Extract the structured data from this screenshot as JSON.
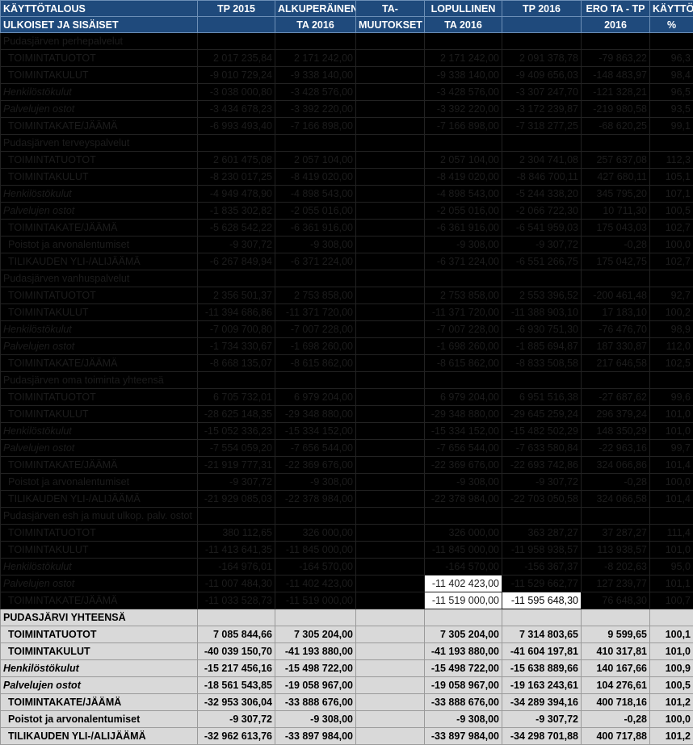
{
  "header": {
    "c1": [
      "KÄYTTÖTALOUS",
      "ULKOISET JA SISÄISET"
    ],
    "c2": [
      "TP 2015",
      ""
    ],
    "c3": [
      "ALKUPERÄINEN",
      "TA 2016"
    ],
    "c4": [
      "TA-",
      "MUUTOKSET"
    ],
    "c5": [
      "LOPULLINEN",
      "TA 2016"
    ],
    "c6": [
      "TP 2016",
      ""
    ],
    "c7": [
      "ERO TA - TP",
      "2016"
    ],
    "c8": [
      "KÄYTTÖ",
      "%"
    ]
  },
  "dark_rows": [
    {
      "label": "Pudasjärven perhepalvelut",
      "style": "sec",
      "v": [
        "",
        "",
        "",
        "",
        "",
        "",
        ""
      ]
    },
    {
      "label": "TOIMINTATUOTOT",
      "style": "sub",
      "v": [
        "2 017 235,84",
        "2 171 242,00",
        "",
        "2 171 242,00",
        "2 091 378,78",
        "-79 863,22",
        "96,3"
      ]
    },
    {
      "label": "TOIMINTAKULUT",
      "style": "sub",
      "v": [
        "-9 010 729,24",
        "-9 338 140,00",
        "",
        "-9 338 140,00",
        "-9 409 656,03",
        "-148 483,97",
        "98,4"
      ]
    },
    {
      "label": "Henkilöstökulut",
      "style": "it",
      "v": [
        "-3 038 000,80",
        "-3 428 576,00",
        "",
        "-3 428 576,00",
        "-3 307 247,70",
        "-121 328,21",
        "96,5"
      ]
    },
    {
      "label": "Palvelujen ostot",
      "style": "it",
      "v": [
        "-3 434 678,23",
        "-3 392 220,00",
        "",
        "-3 392 220,00",
        "-3 172 239,87",
        "-219 980,58",
        "93,5"
      ]
    },
    {
      "label": "TOIMINTAKATE/JÄÄMÄ",
      "style": "sub",
      "v": [
        "-6 993 493,40",
        "-7 166 898,00",
        "",
        "-7 166 898,00",
        "-7 318 277,25",
        "-68 620,25",
        "99,1"
      ]
    },
    {
      "label": "Pudasjärven terveyspalvelut",
      "style": "sec",
      "v": [
        "",
        "",
        "",
        "",
        "",
        "",
        ""
      ]
    },
    {
      "label": "TOIMINTATUOTOT",
      "style": "sub",
      "v": [
        "2 601 475,08",
        "2 057 104,00",
        "",
        "2 057 104,00",
        "2 304 741,08",
        "257 637,08",
        "112,3"
      ]
    },
    {
      "label": "TOIMINTAKULUT",
      "style": "sub",
      "v": [
        "-8 230 017,25",
        "-8 419 020,00",
        "",
        "-8 419 020,00",
        "-8 846 700,11",
        "427 680,11",
        "105,1"
      ]
    },
    {
      "label": "Henkilöstökulut",
      "style": "it",
      "v": [
        "-4 949 478,90",
        "-4 898 543,00",
        "",
        "-4 898 543,00",
        "-5 244 338,20",
        "345 795,20",
        "107,1"
      ]
    },
    {
      "label": "Palvelujen ostot",
      "style": "it",
      "v": [
        "-1 835 302,82",
        "-2 055 016,00",
        "",
        "-2 055 016,00",
        "-2 066 722,30",
        "10 711,30",
        "100,5"
      ]
    },
    {
      "label": "TOIMINTAKATE/JÄÄMÄ",
      "style": "sub",
      "v": [
        "-5 628 542,22",
        "-6 361 916,00",
        "",
        "-6 361 916,00",
        "-6 541 959,03",
        "175 043,03",
        "102,7"
      ]
    },
    {
      "label": "Poistot ja arvonalentumiset",
      "style": "sub",
      "v": [
        "-9 307,72",
        "-9 308,00",
        "",
        "-9 308,00",
        "-9 307,72",
        "-0,28",
        "100,0"
      ]
    },
    {
      "label": "TILIKAUDEN YLI-/ALIJÄÄMÄ",
      "style": "sub",
      "v": [
        "-6 267 849,94",
        "-6 371 224,00",
        "",
        "-6 371 224,00",
        "-6 551 266,75",
        "175 042,75",
        "102,7"
      ]
    },
    {
      "label": "Pudasjärven vanhuspalvelut",
      "style": "sec",
      "v": [
        "",
        "",
        "",
        "",
        "",
        "",
        ""
      ]
    },
    {
      "label": "TOIMINTATUOTOT",
      "style": "sub",
      "v": [
        "2 356 501,37",
        "2 753 858,00",
        "",
        "2 753 858,00",
        "2 553 396,52",
        "-200 461,48",
        "92,7"
      ]
    },
    {
      "label": "TOIMINTAKULUT",
      "style": "sub",
      "v": [
        "-11 394 686,86",
        "-11 371 720,00",
        "",
        "-11 371 720,00",
        "-11 388 903,10",
        "17 183,10",
        "100,2"
      ]
    },
    {
      "label": "Henkilöstökulut",
      "style": "it",
      "v": [
        "-7 009 700,80",
        "-7 007 228,00",
        "",
        "-7 007 228,00",
        "-6 930 751,30",
        "-76 476,70",
        "98,9"
      ]
    },
    {
      "label": "Palvelujen ostot",
      "style": "it",
      "v": [
        "-1 734 330,67",
        "-1 698 260,00",
        "",
        "-1 698 260,00",
        "-1 885 694,87",
        "187 330,87",
        "112,0"
      ]
    },
    {
      "label": "TOIMINTAKATE/JÄÄMÄ",
      "style": "sub",
      "v": [
        "-8 668 135,07",
        "-8 615 862,00",
        "",
        "-8 615 862,00",
        "-8 833 508,58",
        "217 646,58",
        "102,5"
      ]
    },
    {
      "label": "Pudasjärven oma toiminta yhteensä",
      "style": "sec",
      "v": [
        "",
        "",
        "",
        "",
        "",
        "",
        ""
      ]
    },
    {
      "label": "TOIMINTATUOTOT",
      "style": "sub",
      "v": [
        "6 705 732,01",
        "6 979 204,00",
        "",
        "6 979 204,00",
        "6 951 516,38",
        "-27 687,62",
        "99,6"
      ]
    },
    {
      "label": "TOIMINTAKULUT",
      "style": "sub",
      "v": [
        "-28 625 148,35",
        "-29 348 880,00",
        "",
        "-29 348 880,00",
        "-29 645 259,24",
        "296 379,24",
        "101,0"
      ]
    },
    {
      "label": "Henkilöstökulut",
      "style": "it",
      "v": [
        "-15 052 336,23",
        "-15 334 152,00",
        "",
        "-15 334 152,00",
        "-15 482 502,29",
        "148 350,29",
        "101,0"
      ]
    },
    {
      "label": "Palvelujen ostot",
      "style": "it",
      "v": [
        "-7 554 059,20",
        "-7 656 544,00",
        "",
        "-7 656 544,00",
        "-7 633 580,84",
        "-22 963,16",
        "99,7"
      ]
    },
    {
      "label": "TOIMINTAKATE/JÄÄMÄ",
      "style": "sub",
      "v": [
        "-21 919 777,31",
        "-22 369 676,00",
        "",
        "-22 369 676,00",
        "-22 693 742,86",
        "324 066,86",
        "101,4"
      ]
    },
    {
      "label": "Poistot ja arvonalentumiset",
      "style": "sub",
      "v": [
        "-9 307,72",
        "-9 308,00",
        "",
        "-9 308,00",
        "-9 307,72",
        "-0,28",
        "100,0"
      ]
    },
    {
      "label": "TILIKAUDEN YLI-/ALIJÄÄMÄ",
      "style": "sub",
      "v": [
        "-21 929 085,03",
        "-22 378 984,00",
        "",
        "-22 378 984,00",
        "-22 703 050,58",
        "324 066,58",
        "101,4"
      ]
    },
    {
      "label": "Pudasjärven esh ja muut ulkop. palv. ostot",
      "style": "sec",
      "v": [
        "",
        "",
        "",
        "",
        "",
        "",
        ""
      ]
    },
    {
      "label": "TOIMINTATUOTOT",
      "style": "sub",
      "v": [
        "380 112,65",
        "326 000,00",
        "",
        "326 000,00",
        "363 287,27",
        "37 287,27",
        "111,4"
      ]
    },
    {
      "label": "TOIMINTAKULUT",
      "style": "sub",
      "v": [
        "-11 413 641,35",
        "-11 845 000,00",
        "",
        "-11 845 000,00",
        "-11 958 938,57",
        "113 938,57",
        "101,0"
      ]
    },
    {
      "label": "Henkilöstökulut",
      "style": "it",
      "v": [
        "-164 976,01",
        "-164 570,00",
        "",
        "-164 570,00",
        "-156 367,37",
        "-8 202,63",
        "95,0"
      ]
    },
    {
      "label": "Palvelujen ostot",
      "style": "it",
      "v": [
        "-11 007 484,30",
        "-11 402 423,00",
        "",
        "-11 402 423,00",
        "-11 529 662,77",
        "127 239,77",
        "101,1"
      ]
    },
    {
      "label": "TOIMINTAKATE/JÄÄMÄ",
      "style": "sub",
      "v": [
        "-11 033 528,73",
        "-11 519 000,00",
        "",
        "-11 519 000,00",
        "-11 595 648,30",
        "76 648,30",
        "100,7"
      ]
    }
  ],
  "light_rows": [
    {
      "label": "PUDASJÄRVI YHTEENSÄ",
      "style": "sec",
      "v": [
        "",
        "",
        "",
        "",
        "",
        "",
        ""
      ]
    },
    {
      "label": "TOIMINTATUOTOT",
      "style": "sub",
      "v": [
        "7 085 844,66",
        "7 305 204,00",
        "",
        "7 305 204,00",
        "7 314 803,65",
        "9 599,65",
        "100,1"
      ]
    },
    {
      "label": "TOIMINTAKULUT",
      "style": "sub",
      "v": [
        "-40 039 150,70",
        "-41 193 880,00",
        "",
        "-41 193 880,00",
        "-41 604 197,81",
        "410 317,81",
        "101,0"
      ]
    },
    {
      "label": "Henkilöstökulut",
      "style": "it",
      "v": [
        "-15 217 456,16",
        "-15 498 722,00",
        "",
        "-15 498 722,00",
        "-15 638 889,66",
        "140 167,66",
        "100,9"
      ]
    },
    {
      "label": "Palvelujen ostot",
      "style": "it",
      "v": [
        "-18 561 543,85",
        "-19 058 967,00",
        "",
        "-19 058 967,00",
        "-19 163 243,61",
        "104 276,61",
        "100,5"
      ]
    },
    {
      "label": "TOIMINTAKATE/JÄÄMÄ",
      "style": "sub",
      "v": [
        "-32 953 306,04",
        "-33 888 676,00",
        "",
        "-33 888 676,00",
        "-34 289 394,16",
        "400 718,16",
        "101,2"
      ]
    },
    {
      "label": "Poistot ja arvonalentumiset",
      "style": "sub",
      "v": [
        "-9 307,72",
        "-9 308,00",
        "",
        "-9 308,00",
        "-9 307,72",
        "-0,28",
        "100,0"
      ]
    },
    {
      "label": "TILIKAUDEN YLI-/ALIJÄÄMÄ",
      "style": "sub",
      "v": [
        "-32 962 613,76",
        "-33 897 984,00",
        "",
        "-33 897 984,00",
        "-34 298 701,88",
        "400 717,88",
        "101,2"
      ]
    }
  ]
}
